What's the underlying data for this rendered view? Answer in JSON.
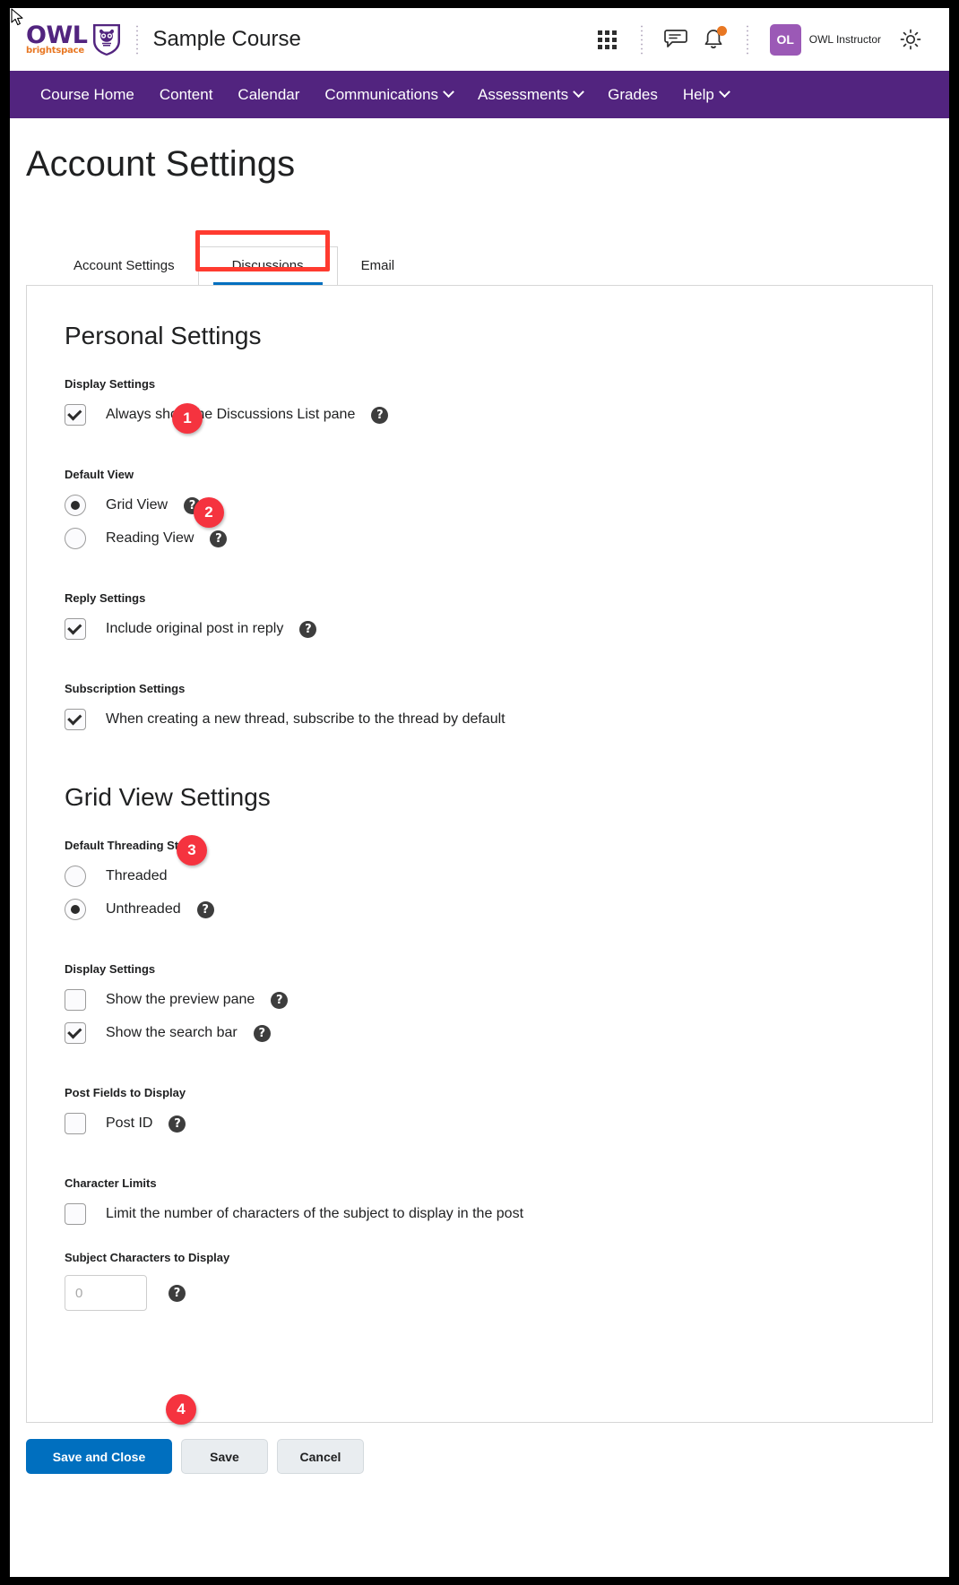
{
  "header": {
    "logo_owl": "OWL",
    "logo_sub": "brightspace",
    "course_title": "Sample Course",
    "waffle_icon": "grid-apps-icon",
    "message_icon": "message-icon",
    "bell_icon": "notification-bell-icon",
    "avatar_initials": "OL",
    "user_name": "OWL Instructor",
    "gear_icon": "settings-gear-icon"
  },
  "nav": {
    "items": [
      {
        "label": "Course Home",
        "has_caret": false
      },
      {
        "label": "Content",
        "has_caret": false
      },
      {
        "label": "Calendar",
        "has_caret": false
      },
      {
        "label": "Communications",
        "has_caret": true
      },
      {
        "label": "Assessments",
        "has_caret": true
      },
      {
        "label": "Grades",
        "has_caret": false
      },
      {
        "label": "Help",
        "has_caret": true
      }
    ]
  },
  "page": {
    "title": "Account Settings"
  },
  "tabs": [
    {
      "label": "Account Settings",
      "active": false
    },
    {
      "label": "Discussions",
      "active": true
    },
    {
      "label": "Email",
      "active": false
    }
  ],
  "personal": {
    "heading": "Personal Settings",
    "display_settings_label": "Display Settings",
    "always_show_label": "Always show the Discussions List pane",
    "always_show_checked": true,
    "default_view_label": "Default View",
    "grid_view_label": "Grid View",
    "reading_view_label": "Reading View",
    "default_view_selected": "Grid View",
    "reply_settings_label": "Reply Settings",
    "include_original_label": "Include original post in reply",
    "include_original_checked": true,
    "subscription_settings_label": "Subscription Settings",
    "subscribe_label": "When creating a new thread, subscribe to the thread by default",
    "subscribe_checked": true
  },
  "grid": {
    "heading": "Grid View Settings",
    "threading_label": "Default Threading Style",
    "threaded_label": "Threaded",
    "unthreaded_label": "Unthreaded",
    "threading_selected": "Unthreaded",
    "display_settings_label": "Display Settings",
    "preview_pane_label": "Show the preview pane",
    "preview_pane_checked": false,
    "search_bar_label": "Show the search bar",
    "search_bar_checked": true,
    "post_fields_label": "Post Fields to Display",
    "post_id_label": "Post ID",
    "post_id_checked": false,
    "character_limits_label": "Character Limits",
    "limit_chars_label": "Limit the number of characters of the subject to display in the post",
    "limit_chars_checked": false,
    "subject_chars_label": "Subject Characters to Display",
    "subject_chars_value": "",
    "subject_chars_placeholder": "0"
  },
  "footer": {
    "save_and_close": "Save and Close",
    "save": "Save",
    "cancel": "Cancel"
  },
  "annotations": {
    "badge1": "1",
    "badge2": "2",
    "badge3": "3",
    "badge4": "4",
    "highlight_color": "#FF3B30"
  },
  "help_icon_glyph": "?"
}
